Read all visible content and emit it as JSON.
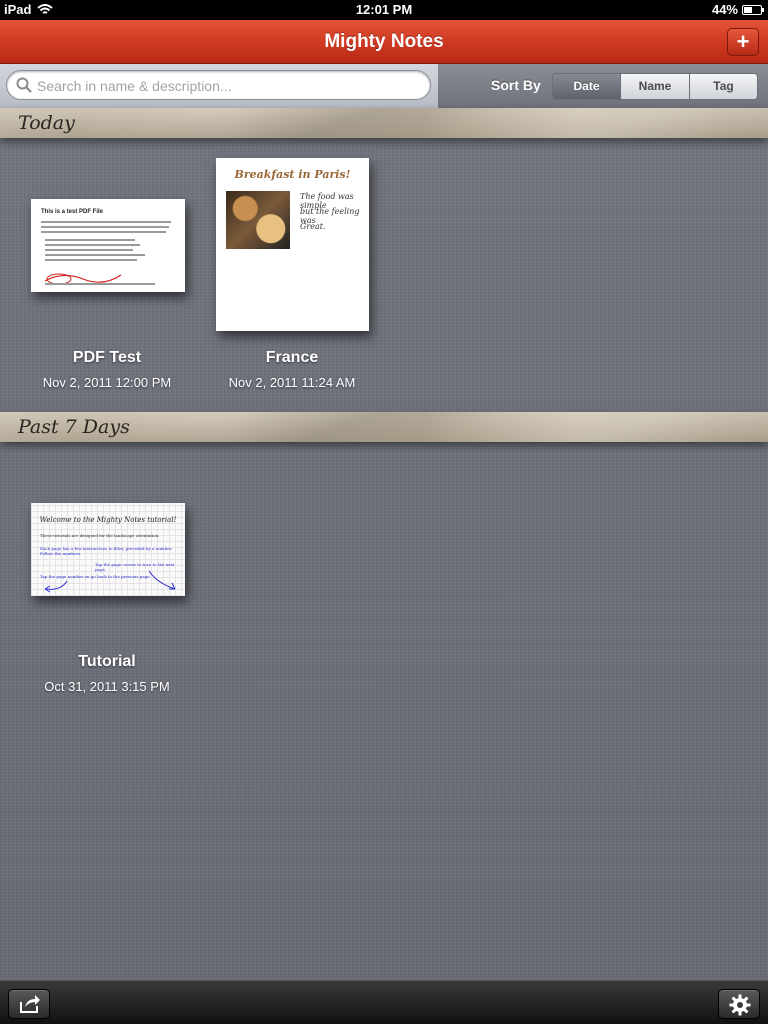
{
  "status_bar": {
    "device": "iPad",
    "time": "12:01 PM",
    "battery": "44%"
  },
  "header": {
    "title": "Mighty Notes",
    "add_label": "+"
  },
  "search": {
    "placeholder": "Search in name & description..."
  },
  "sort": {
    "label": "Sort By",
    "options": [
      "Date",
      "Name",
      "Tag"
    ],
    "selected": "Date"
  },
  "sections": [
    {
      "title": "Today",
      "notes": [
        {
          "name": "PDF Test",
          "date": "Nov 2, 2011 12:00 PM",
          "thumb_heading": "This is a test PDF File"
        },
        {
          "name": "France",
          "date": "Nov 2, 2011 11:24 AM",
          "thumb_heading": "Breakfast in Paris!",
          "thumb_lines": [
            "The food was simple",
            "but the feeling was",
            "Great."
          ]
        }
      ]
    },
    {
      "title": "Past 7 Days",
      "notes": [
        {
          "name": "Tutorial",
          "date": "Oct 31, 2011 3:15 PM",
          "thumb_heading": "Welcome to the Mighty Notes tutorial!"
        }
      ]
    }
  ],
  "icons": {
    "wifi": "wifi-icon",
    "battery": "battery-icon",
    "search": "search-icon",
    "share": "share-icon",
    "settings": "gear-icon"
  },
  "colors": {
    "header_red": "#cf3a22",
    "background_gray": "#6c6e78"
  }
}
